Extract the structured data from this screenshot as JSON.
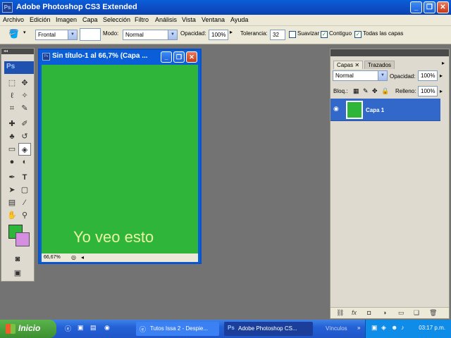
{
  "window": {
    "title": "Adobe Photoshop CS3 Extended",
    "app_icon": "Ps"
  },
  "menu": [
    "Archivo",
    "Edición",
    "Imagen",
    "Capa",
    "Selección",
    "Filtro",
    "Análisis",
    "Vista",
    "Ventana",
    "Ayuda"
  ],
  "options": {
    "fill_source": "Frontal",
    "mode_label": "Modo:",
    "mode_value": "Normal",
    "opacity_label": "Opacidad:",
    "opacity_value": "100%",
    "tolerance_label": "Tolerancia:",
    "tolerance_value": "32",
    "antialias_label": "Suavizar",
    "contiguous_label": "Contiguo",
    "all_layers_label": "Todas las capas"
  },
  "toolbox": {
    "logo": "Ps"
  },
  "document": {
    "title": "Sin título-1 al 66,7% (Capa ...",
    "canvas_text": "Yo veo esto",
    "zoom": "66,67%",
    "canvas_color": "#2fb53a"
  },
  "layers_panel": {
    "tab_layers": "Capas",
    "tab_paths": "Trazados",
    "blend_mode": "Normal",
    "opacity_label": "Opacidad:",
    "opacity_value": "100%",
    "lock_label": "Bloq.:",
    "fill_label": "Relleno:",
    "fill_value": "100%",
    "layer_name": "Capa 1"
  },
  "taskbar": {
    "start": "Inicio",
    "tasks": [
      "Tutos Issa 2 - Despie...",
      "Adobe Photoshop CS..."
    ],
    "tray_label": "Vínculos",
    "clock": "03:17 p.m."
  },
  "colors": {
    "foreground": "#2fb53a",
    "background": "#d68ee0",
    "accent": "#0a5fd8"
  }
}
